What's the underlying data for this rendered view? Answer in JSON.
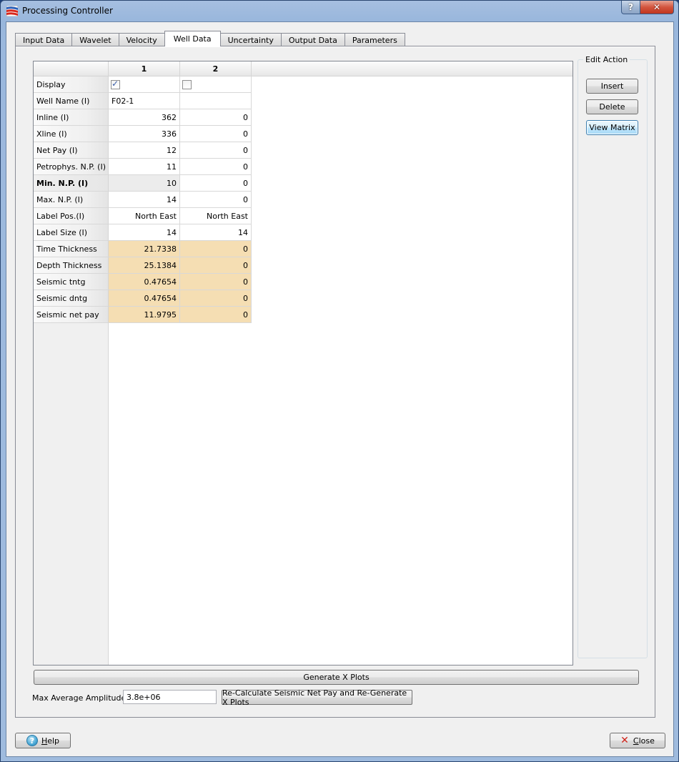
{
  "window": {
    "title": "Processing Controller",
    "help_button": "?",
    "close_button": "✕"
  },
  "tabs": [
    {
      "label": "Input Data",
      "active": false
    },
    {
      "label": "Wavelet",
      "active": false
    },
    {
      "label": "Velocity",
      "active": false
    },
    {
      "label": "Well Data",
      "active": true
    },
    {
      "label": "Uncertainty",
      "active": false
    },
    {
      "label": "Output Data",
      "active": false
    },
    {
      "label": "Parameters",
      "active": false
    }
  ],
  "table": {
    "columns": [
      "1",
      "2"
    ],
    "rows": [
      {
        "label": "Display",
        "values": [
          true,
          false
        ],
        "type": "checkbox"
      },
      {
        "label": "Well Name (I)",
        "values": [
          "F02-1",
          ""
        ],
        "type": "text"
      },
      {
        "label": "Inline (I)",
        "values": [
          "362",
          "0"
        ],
        "type": "number"
      },
      {
        "label": "Xline (I)",
        "values": [
          "336",
          "0"
        ],
        "type": "number"
      },
      {
        "label": "Net Pay (I)",
        "values": [
          "12",
          "0"
        ],
        "type": "number"
      },
      {
        "label": "Petrophys. N.P. (I)",
        "values": [
          "11",
          "0"
        ],
        "type": "number"
      },
      {
        "label": "Min. N.P. (I)",
        "values": [
          "10",
          "0"
        ],
        "type": "number",
        "selected": true
      },
      {
        "label": "Max. N.P. (I)",
        "values": [
          "14",
          "0"
        ],
        "type": "number"
      },
      {
        "label": "Label Pos.(I)",
        "values": [
          "North East",
          "North East"
        ],
        "type": "number"
      },
      {
        "label": "Label Size (I)",
        "values": [
          "14",
          "14"
        ],
        "type": "number"
      },
      {
        "label": "Time Thickness",
        "values": [
          "21.7338",
          "0"
        ],
        "type": "computed"
      },
      {
        "label": "Depth Thickness",
        "values": [
          "25.1384",
          "0"
        ],
        "type": "computed"
      },
      {
        "label": "Seismic tntg",
        "values": [
          "0.47654",
          "0"
        ],
        "type": "computed"
      },
      {
        "label": "Seismic dntg",
        "values": [
          "0.47654",
          "0"
        ],
        "type": "computed"
      },
      {
        "label": "Seismic net pay",
        "values": [
          "11.9795",
          "0"
        ],
        "type": "computed"
      }
    ]
  },
  "edit_action": {
    "title": "Edit Action",
    "insert": "Insert",
    "delete": "Delete",
    "view_matrix": "View Matrix"
  },
  "generate_x_plots": "Generate X Plots",
  "max_avg_amplitude": {
    "label": "Max Average Amplitude:",
    "value": "3.8e+06"
  },
  "recalculate_button": "Re-Calculate Seismic Net Pay and Re-Generate X Plots",
  "footer": {
    "help_mnemonic": "H",
    "help_rest": "elp",
    "close_mnemonic": "C",
    "close_rest": "lose"
  },
  "colors": {
    "computed_cell": "#f5deb3",
    "focus_button": "#bee6fd"
  }
}
